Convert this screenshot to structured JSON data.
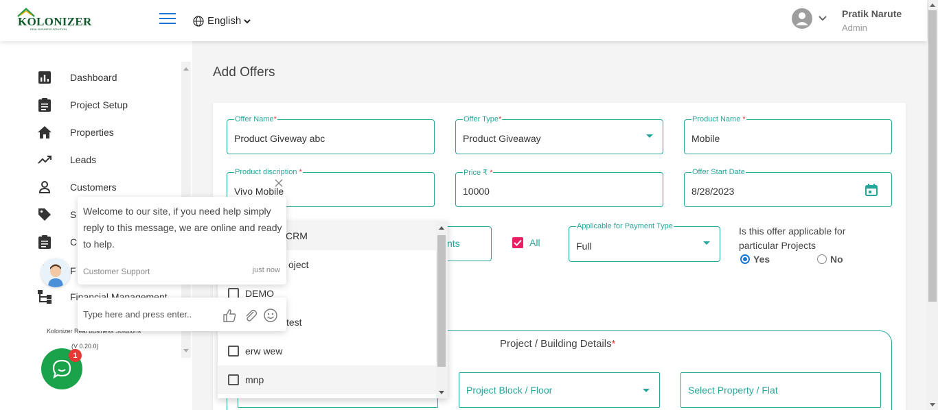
{
  "header": {
    "logo_text": "KOLONIZER",
    "logo_subtext": "REAL BUSINESS SOLUTION",
    "language": "English",
    "user_name": "Pratik Narute",
    "user_role": "Admin"
  },
  "sidebar": {
    "items": [
      {
        "label": "Dashboard",
        "icon": "dashboard-icon"
      },
      {
        "label": "Project Setup",
        "icon": "clipboard-icon"
      },
      {
        "label": "Properties",
        "icon": "home-icon"
      },
      {
        "label": "Leads",
        "icon": "trending-up-icon"
      },
      {
        "label": "Customers",
        "icon": "person-icon"
      },
      {
        "label": "S",
        "icon": "tag-icon"
      },
      {
        "label": "C",
        "icon": "clipboard-icon"
      },
      {
        "label": "F",
        "icon": "info-icon"
      },
      {
        "label": "Financial Management",
        "icon": "hierarchy-icon"
      }
    ],
    "footer_company": "Kolonizer Real Business Solutions",
    "footer_version": "(V 0.20.0)"
  },
  "page": {
    "title": "Add Offers"
  },
  "form": {
    "offer_name": {
      "label": "Offer Name",
      "required": "*",
      "value": "Product Giveway abc"
    },
    "offer_type": {
      "label": "Offer Type",
      "required": "*",
      "value": "Product Giveaway"
    },
    "product_name": {
      "label": "Product Name ",
      "required": "*",
      "value": "Mobile"
    },
    "product_description": {
      "label": "Product discription ",
      "required": "*",
      "value": "Vivo Mobile"
    },
    "price": {
      "label": "Price ₹ ",
      "required": "*",
      "value": "10000"
    },
    "offer_start_date": {
      "label": "Offer Start Date",
      "value": "8/28/2023"
    },
    "partial_field_text": "nts",
    "all_checkbox_label": "All",
    "payment_type": {
      "label": "Applicable for Payment Type",
      "value": "Full"
    },
    "projects_question": "Is this offer applicable for particular Projects",
    "radio_yes": "Yes",
    "radio_no": "No",
    "project_section_title": "Project / Building Details",
    "project_section_required": "*",
    "project_block_placeholder": "Project Block / Floor",
    "property_placeholder": "Select Property / Flat"
  },
  "dropdown": {
    "items": [
      {
        "label": "CRM",
        "highlight": true,
        "checkbox": false
      },
      {
        "label": "oject",
        "highlight": false,
        "checkbox": false
      },
      {
        "label": "DEMO",
        "highlight": false,
        "checkbox": true
      },
      {
        "label": "test",
        "highlight": false,
        "checkbox": false
      },
      {
        "label": "erw wew",
        "highlight": false,
        "checkbox": true
      },
      {
        "label": "mnp",
        "highlight": true,
        "checkbox": true
      }
    ]
  },
  "chat": {
    "message": "Welcome to our site, if you need help simply reply to this message, we are online and ready to help.",
    "sender": "Customer Support",
    "time": "just now",
    "input_placeholder": "Type here and press enter..",
    "badge_count": "1"
  },
  "colors": {
    "accent": "#26a69a",
    "required": "#e53935",
    "brand_blue": "#1976d2",
    "checkbox_pink": "#e91e63",
    "chat_green": "#1aa34a"
  }
}
